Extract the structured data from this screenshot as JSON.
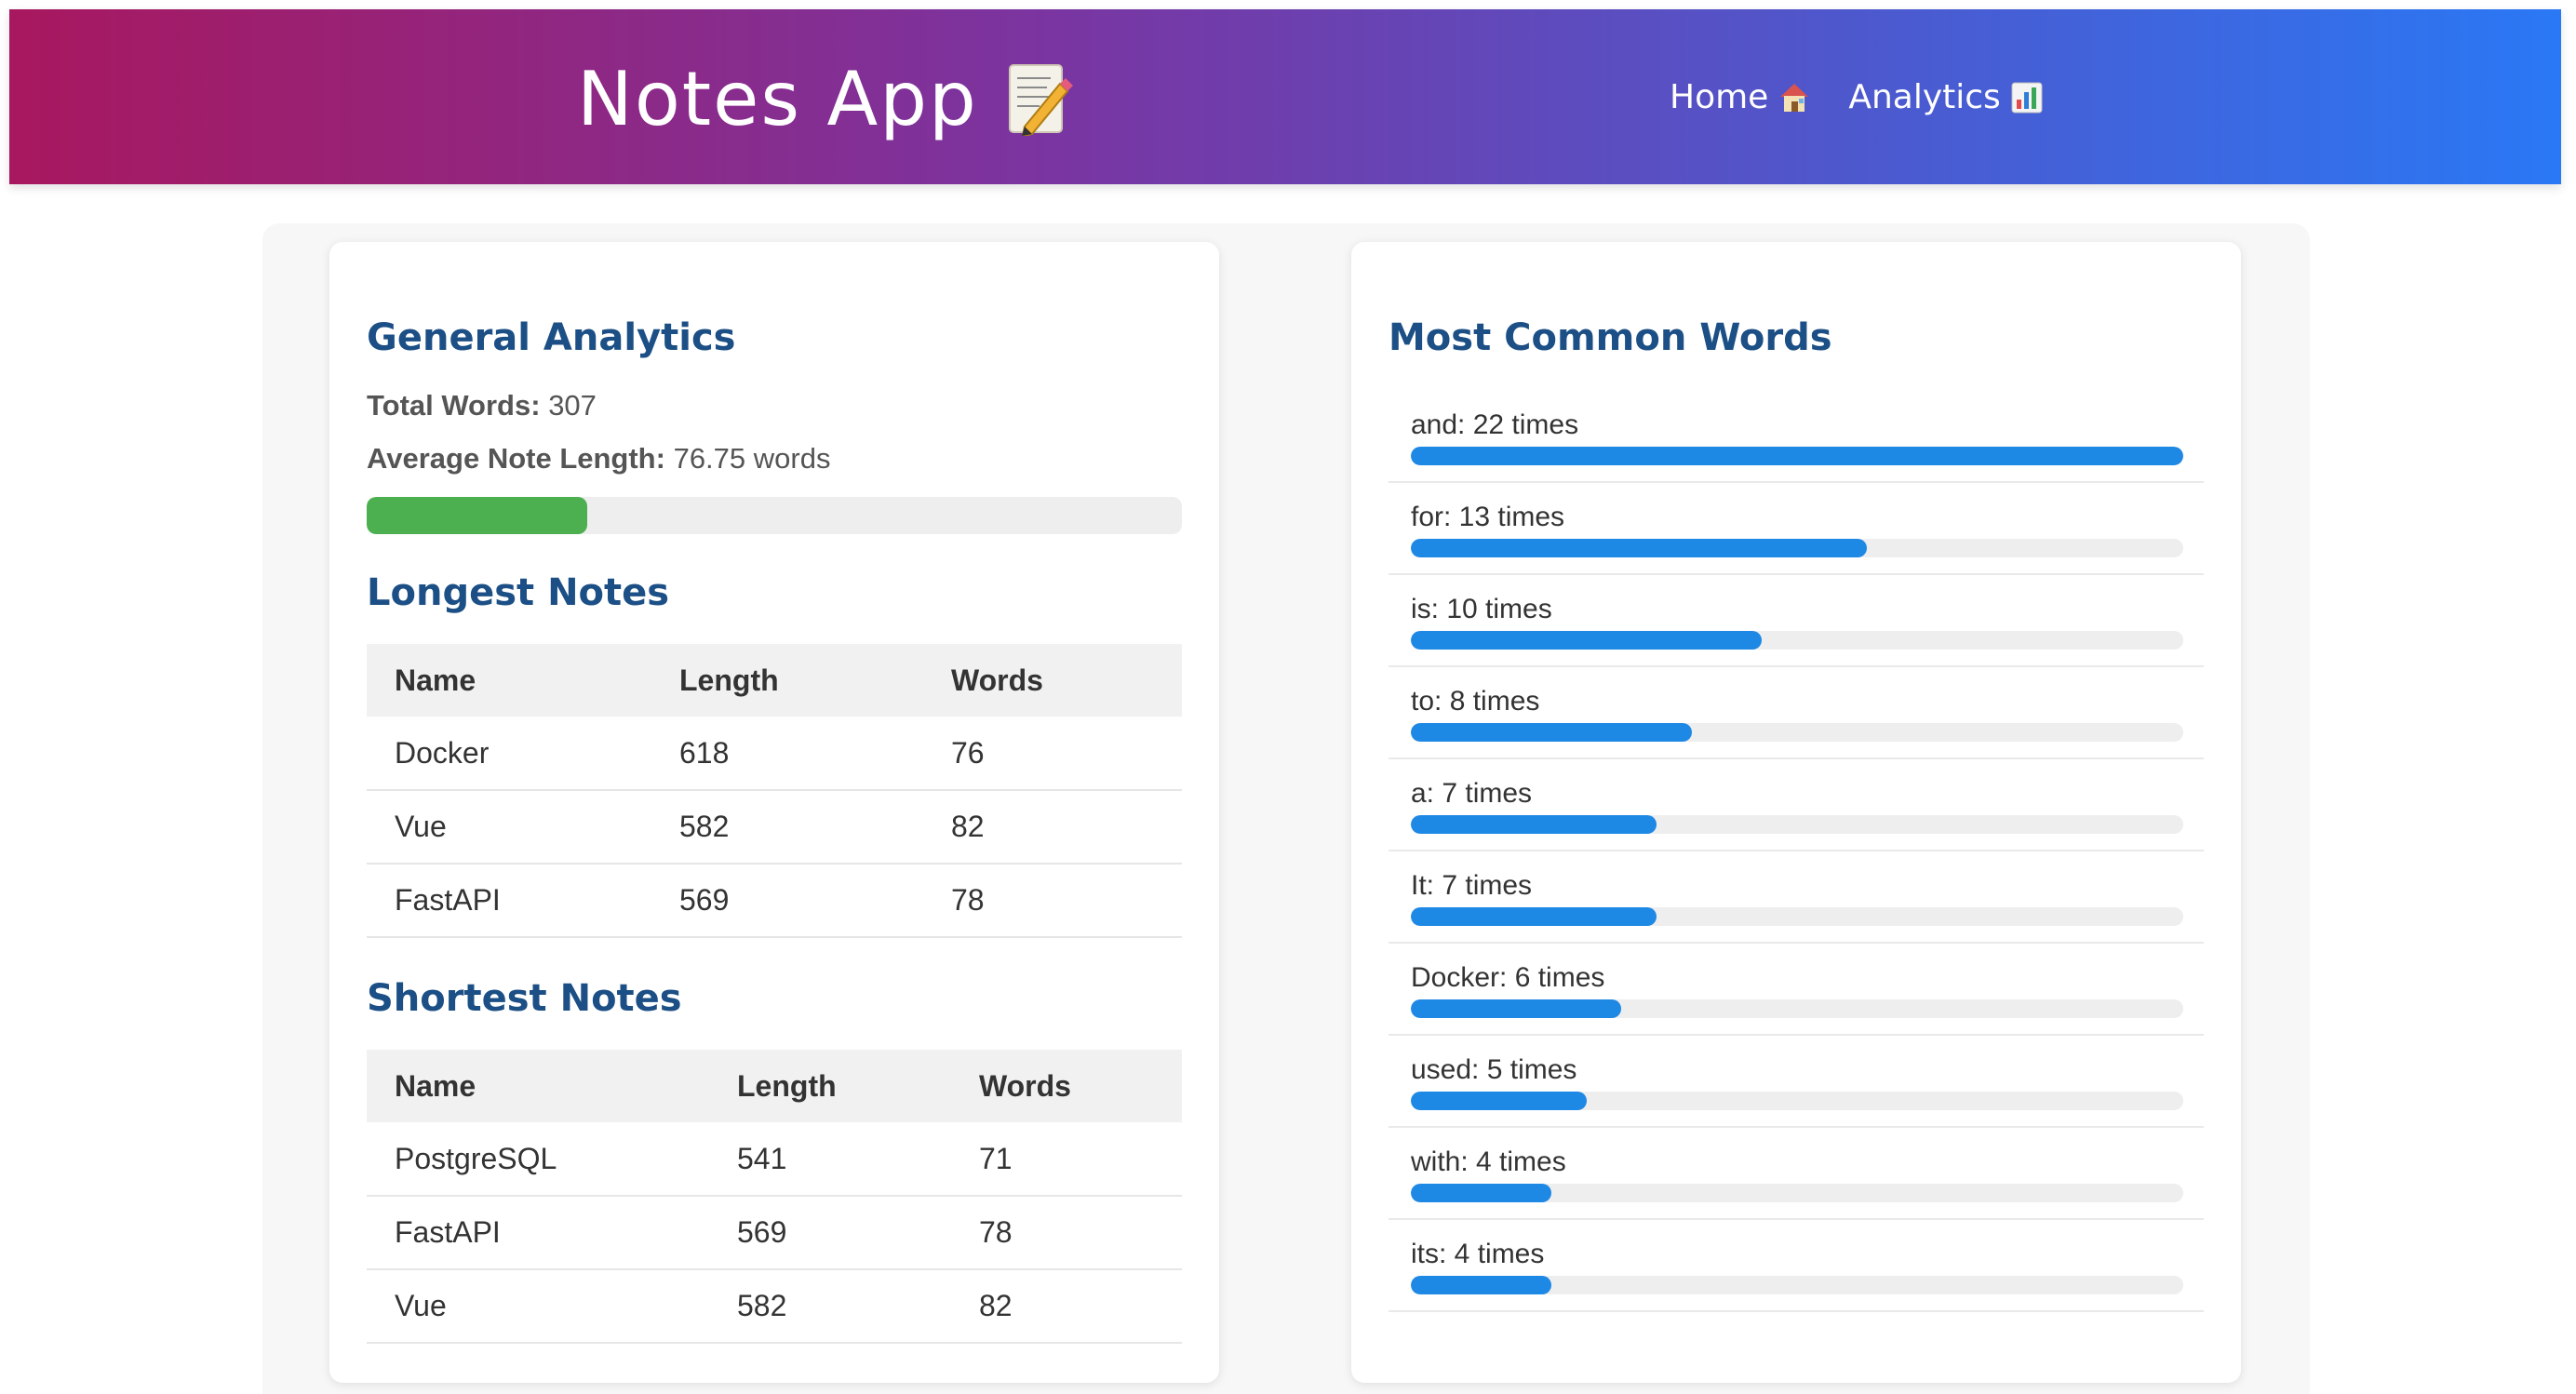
{
  "header": {
    "app_title": "Notes App",
    "nav": [
      {
        "label": "Home",
        "icon": "house-icon"
      },
      {
        "label": "Analytics",
        "icon": "bar-chart-icon"
      }
    ]
  },
  "general": {
    "title": "General Analytics",
    "total_words_label": "Total Words:",
    "total_words_value": "307",
    "avg_label": "Average Note Length:",
    "avg_value": "76.75 words",
    "progress_fraction": 0.27,
    "progress_color": "#4caf50"
  },
  "longest": {
    "title": "Longest Notes",
    "columns": [
      "Name",
      "Length",
      "Words"
    ],
    "rows": [
      [
        "Docker",
        "618",
        "76"
      ],
      [
        "Vue",
        "582",
        "82"
      ],
      [
        "FastAPI",
        "569",
        "78"
      ]
    ]
  },
  "shortest": {
    "title": "Shortest Notes",
    "columns": [
      "Name",
      "Length",
      "Words"
    ],
    "rows": [
      [
        "PostgreSQL",
        "541",
        "71"
      ],
      [
        "FastAPI",
        "569",
        "78"
      ],
      [
        "Vue",
        "582",
        "82"
      ]
    ]
  },
  "common_words": {
    "title": "Most Common Words",
    "bar_color": "#1e88e5",
    "items": [
      {
        "label": "and: 22 times",
        "count": 22
      },
      {
        "label": "for: 13 times",
        "count": 13
      },
      {
        "label": "is: 10 times",
        "count": 10
      },
      {
        "label": "to: 8 times",
        "count": 8
      },
      {
        "label": "a: 7 times",
        "count": 7
      },
      {
        "label": "It: 7 times",
        "count": 7
      },
      {
        "label": "Docker: 6 times",
        "count": 6
      },
      {
        "label": "used: 5 times",
        "count": 5
      },
      {
        "label": "with: 4 times",
        "count": 4
      },
      {
        "label": "its: 4 times",
        "count": 4
      }
    ]
  }
}
